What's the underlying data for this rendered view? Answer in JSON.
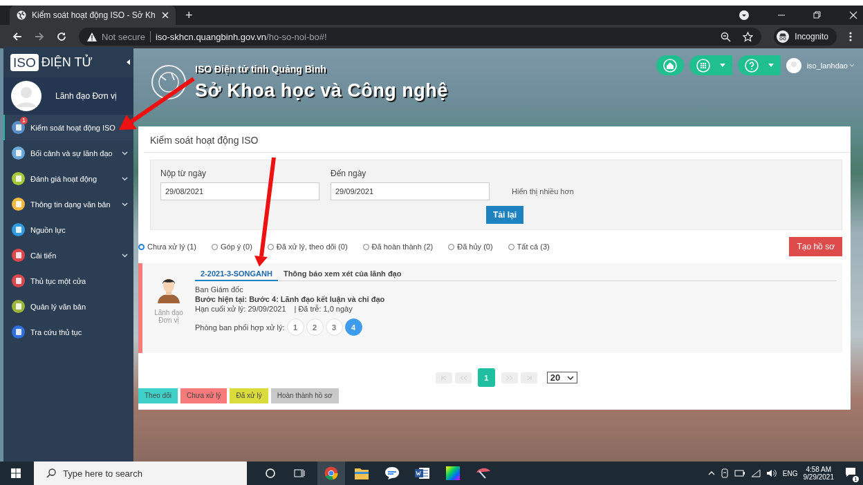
{
  "browser": {
    "tab_title": "Kiểm soát hoạt động ISO - Sở Kh",
    "new_tab": "+",
    "security": "Not secure",
    "url_host": "iso-skhcn.quangbinh.gov.vn",
    "url_path": "/ho-so-noi-bo#!",
    "profile": "Incognito"
  },
  "sidebar": {
    "logo_box": "ISO",
    "logo_text": "ĐIỆN TỬ",
    "user": "Lãnh đạo Đơn vị",
    "items": [
      {
        "label": "Kiểm soát hoạt động ISO",
        "selected": true,
        "badge": "1",
        "expandable": false,
        "color": "#5b8fc9"
      },
      {
        "label": "Bối cảnh và sự lãnh đạo",
        "selected": false,
        "expandable": true,
        "color": "#6aa9d8"
      },
      {
        "label": "Đánh giá hoạt động",
        "selected": false,
        "expandable": true,
        "color": "#a6c93a"
      },
      {
        "label": "Thông tin dạng văn bản",
        "selected": false,
        "expandable": true,
        "color": "#f5b942"
      },
      {
        "label": "Nguồn lực",
        "selected": false,
        "expandable": false,
        "color": "#2f9be0"
      },
      {
        "label": "Cải tiến",
        "selected": false,
        "expandable": true,
        "color": "#e0474c"
      },
      {
        "label": "Thủ tục một cửa",
        "selected": false,
        "expandable": false,
        "color": "#d9484c"
      },
      {
        "label": "Quản lý văn bản",
        "selected": false,
        "expandable": false,
        "color": "#9ab53a"
      },
      {
        "label": "Tra cứu thủ tục",
        "selected": false,
        "expandable": false,
        "color": "#2f6fe0"
      }
    ]
  },
  "header": {
    "subtitle": "ISO Điện tử tỉnh Quảng Bình",
    "title": "Sở Khoa học và Công nghệ",
    "username": "iso_lanhdao"
  },
  "panel": {
    "title": "Kiểm soát hoạt động ISO",
    "filters": [
      {
        "label": "Nộp từ ngày",
        "value": "29/08/2021"
      },
      {
        "label": "Đến ngày",
        "value": "29/09/2021"
      }
    ],
    "more_link": "Hiển thị nhiều hơn",
    "reload_button": "Tải lại",
    "status_options": [
      {
        "label": "Chưa xử lý (1)",
        "selected": true
      },
      {
        "label": "Góp ý (0)",
        "selected": false
      },
      {
        "label": "Đã xử lý, theo dõi (0)",
        "selected": false
      },
      {
        "label": "Đã hoàn thành (2)",
        "selected": false
      },
      {
        "label": "Đã hủy (0)",
        "selected": false
      },
      {
        "label": "Tất cả (3)",
        "selected": false
      }
    ],
    "create_button": "Tạo hồ sơ",
    "records": [
      {
        "color": "#f77b7b",
        "code": "2-2021-3-SONGANH",
        "title": "Thông báo xem xét của lãnh đạo",
        "role": "Lãnh đạo Đơn vị",
        "department": "Ban Giám đốc",
        "step": "Bước hiện tại: Bước 4: Lãnh đạo kết luận và chỉ đạo",
        "deadline": "Hạn cuối xử lý: 29/09/2021",
        "late": "| Đã trễ: 1,0 ngày",
        "steps_label": "Phòng ban phối hợp xử lý:",
        "steps": [
          {
            "label": "1",
            "selected": false
          },
          {
            "label": "2",
            "selected": false
          },
          {
            "label": "3",
            "selected": false
          },
          {
            "label": "4",
            "selected": true
          }
        ]
      }
    ],
    "pagination": {
      "pages": [
        {
          "label": "1",
          "selected": true
        }
      ],
      "page_size": "20"
    },
    "legend": [
      {
        "label": "Theo dõi",
        "color": "#3fd1c9"
      },
      {
        "label": "Chưa xử lý",
        "color": "#f77b7b"
      },
      {
        "label": "Đã xử lý",
        "color": "#d9dc3a"
      },
      {
        "label": "Hoàn thành hồ sơ",
        "color": "#c9c9c9"
      }
    ]
  },
  "taskbar": {
    "search_placeholder": "Type here to search",
    "language": "ENG",
    "time": "4:58 AM",
    "date": "9/29/2021",
    "notification_count": "1"
  }
}
